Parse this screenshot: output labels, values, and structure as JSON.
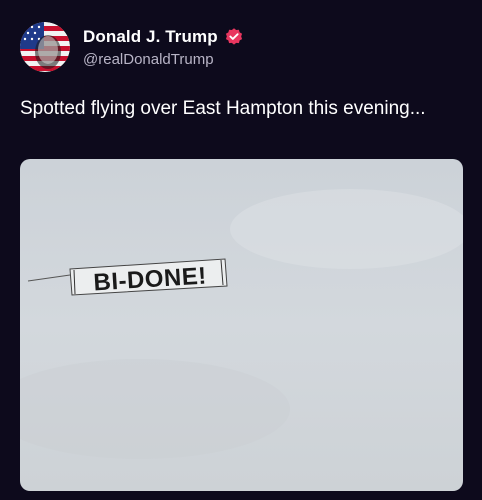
{
  "author": {
    "display_name": "Donald J. Trump",
    "handle": "@realDonaldTrump",
    "verified_badge_icon": "verified-badge-icon",
    "badge_color": "#e8365f"
  },
  "tweet": {
    "text": "Spotted flying over East Hampton this evening..."
  },
  "media": {
    "banner_text": "BI-DONE!",
    "sky_color": "#d3d8dd"
  }
}
